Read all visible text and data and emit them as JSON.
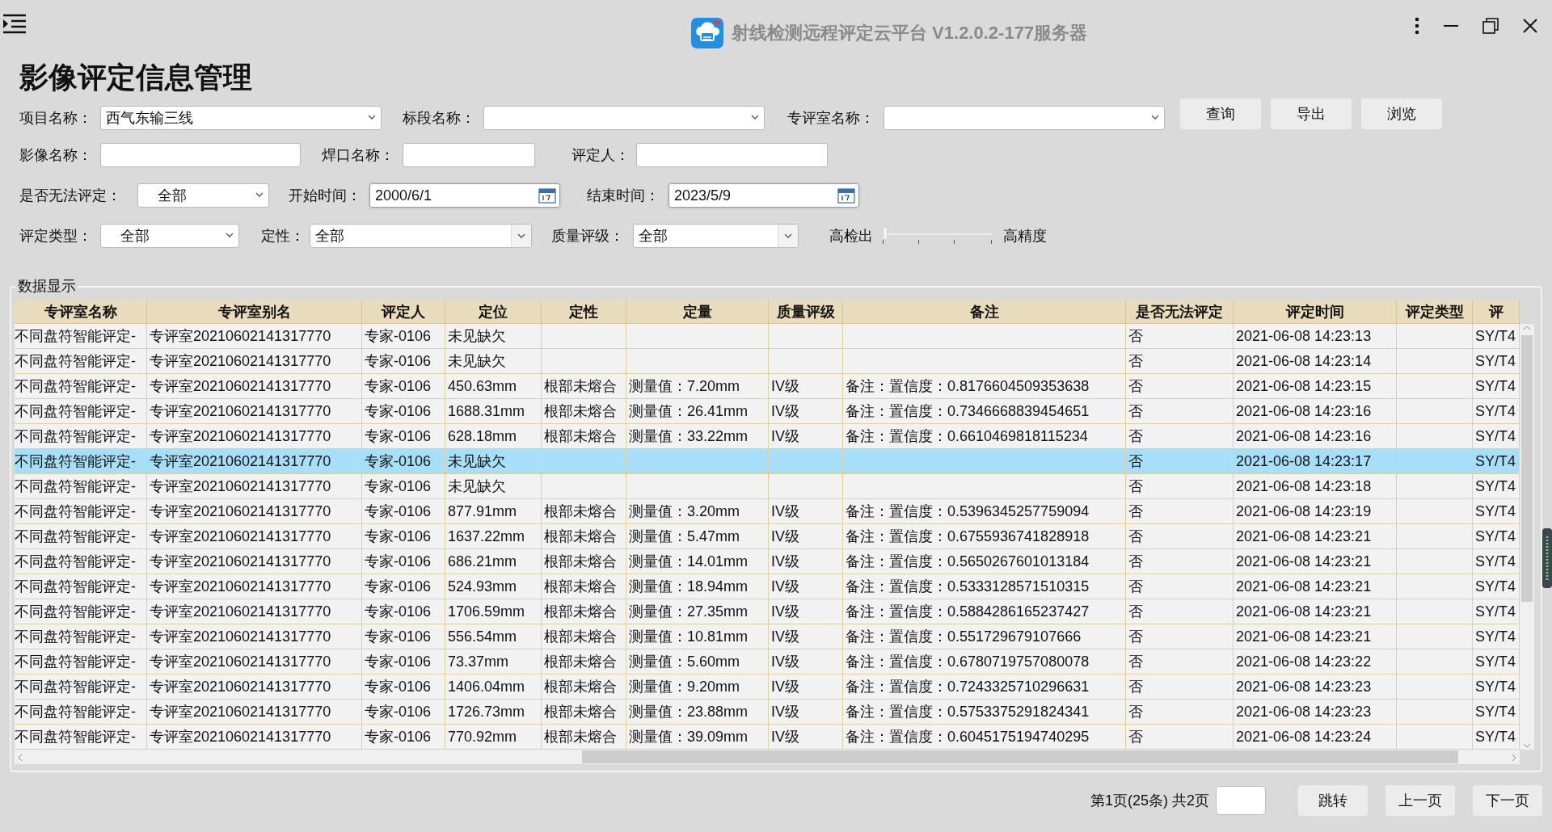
{
  "window": {
    "title": "射线检测远程评定云平台 V1.2.0.2-177服务器"
  },
  "page_title": "影像评定信息管理",
  "filters": [
    {
      "fields": [
        {
          "kind": "select",
          "label": "项目名称：",
          "value": "西气东输三线"
        },
        {
          "kind": "select",
          "label": "标段名称："
        },
        {
          "kind": "select",
          "label": "专评室名称："
        }
      ],
      "buttons": [
        "查询",
        "导出",
        "浏览"
      ]
    },
    {
      "fields": [
        {
          "kind": "text",
          "label": "影像名称："
        },
        {
          "kind": "text",
          "label": "焊口名称："
        },
        {
          "kind": "text",
          "label": "评定人："
        }
      ]
    },
    {
      "fields": [
        {
          "kind": "select",
          "label": "是否无法评定：",
          "value": "全部"
        },
        {
          "kind": "date",
          "label": "开始时间：",
          "value": "2000/6/1"
        },
        {
          "kind": "date",
          "label": "结束时间：",
          "value": "2023/5/9"
        }
      ]
    },
    {
      "fields": [
        {
          "kind": "select",
          "label": "评定类型：",
          "value": "全部"
        },
        {
          "kind": "combo",
          "label": "定性：",
          "value": "全部"
        },
        {
          "kind": "combo",
          "label": "质量评级：",
          "value": "全部"
        },
        {
          "kind": "slider",
          "label_low": "高检出",
          "label_high": "高精度",
          "level": 0
        }
      ]
    }
  ],
  "table": {
    "title": "数据显示",
    "columns": [
      "专评室名称",
      "专评室别名",
      "评定人",
      "定位",
      "定性",
      "定量",
      "质量评级",
      "备注",
      "是否无法评定",
      "评定时间",
      "评定类型",
      "评"
    ],
    "rows": [
      {
        "selected": false,
        "cells": [
          "不同盘符智能评定-",
          "专评室20210602141317770",
          "专家-0106",
          "未见缺欠",
          null,
          null,
          null,
          null,
          "否",
          "2021-06-08 14:23:13",
          null,
          "SY/T4"
        ]
      },
      {
        "selected": false,
        "cells": [
          "不同盘符智能评定-",
          "专评室20210602141317770",
          "专家-0106",
          "未见缺欠",
          null,
          null,
          null,
          null,
          "否",
          "2021-06-08 14:23:14",
          null,
          "SY/T4"
        ]
      },
      {
        "selected": false,
        "cells": [
          "不同盘符智能评定-",
          "专评室20210602141317770",
          "专家-0106",
          "450.63mm",
          "根部未熔合",
          "测量值：7.20mm",
          "IV级",
          "备注：置信度：0.8176604509353638",
          "否",
          "2021-06-08 14:23:15",
          null,
          "SY/T4"
        ]
      },
      {
        "selected": false,
        "cells": [
          "不同盘符智能评定-",
          "专评室20210602141317770",
          "专家-0106",
          "1688.31mm",
          "根部未熔合",
          "测量值：26.41mm",
          "IV级",
          "备注：置信度：0.7346668839454651",
          "否",
          "2021-06-08 14:23:16",
          null,
          "SY/T4"
        ]
      },
      {
        "selected": false,
        "cells": [
          "不同盘符智能评定-",
          "专评室20210602141317770",
          "专家-0106",
          "628.18mm",
          "根部未熔合",
          "测量值：33.22mm",
          "IV级",
          "备注：置信度：0.6610469818115234",
          "否",
          "2021-06-08 14:23:16",
          null,
          "SY/T4"
        ]
      },
      {
        "selected": true,
        "cells": [
          "不同盘符智能评定-",
          "专评室20210602141317770",
          "专家-0106",
          "未见缺欠",
          null,
          null,
          null,
          null,
          "否",
          "2021-06-08 14:23:17",
          null,
          "SY/T4"
        ]
      },
      {
        "selected": false,
        "cells": [
          "不同盘符智能评定-",
          "专评室20210602141317770",
          "专家-0106",
          "未见缺欠",
          null,
          null,
          null,
          null,
          "否",
          "2021-06-08 14:23:18",
          null,
          "SY/T4"
        ]
      },
      {
        "selected": false,
        "cells": [
          "不同盘符智能评定-",
          "专评室20210602141317770",
          "专家-0106",
          "877.91mm",
          "根部未熔合",
          "测量值：3.20mm",
          "IV级",
          "备注：置信度：0.5396345257759094",
          "否",
          "2021-06-08 14:23:19",
          null,
          "SY/T4"
        ]
      },
      {
        "selected": false,
        "cells": [
          "不同盘符智能评定-",
          "专评室20210602141317770",
          "专家-0106",
          "1637.22mm",
          "根部未熔合",
          "测量值：5.47mm",
          "IV级",
          "备注：置信度：0.6755936741828918",
          "否",
          "2021-06-08 14:23:21",
          null,
          "SY/T4"
        ]
      },
      {
        "selected": false,
        "cells": [
          "不同盘符智能评定-",
          "专评室20210602141317770",
          "专家-0106",
          "686.21mm",
          "根部未熔合",
          "测量值：14.01mm",
          "IV级",
          "备注：置信度：0.5650267601013184",
          "否",
          "2021-06-08 14:23:21",
          null,
          "SY/T4"
        ]
      },
      {
        "selected": false,
        "cells": [
          "不同盘符智能评定-",
          "专评室20210602141317770",
          "专家-0106",
          "524.93mm",
          "根部未熔合",
          "测量值：18.94mm",
          "IV级",
          "备注：置信度：0.5333128571510315",
          "否",
          "2021-06-08 14:23:21",
          null,
          "SY/T4"
        ]
      },
      {
        "selected": false,
        "cells": [
          "不同盘符智能评定-",
          "专评室20210602141317770",
          "专家-0106",
          "1706.59mm",
          "根部未熔合",
          "测量值：27.35mm",
          "IV级",
          "备注：置信度：0.5884286165237427",
          "否",
          "2021-06-08 14:23:21",
          null,
          "SY/T4"
        ]
      },
      {
        "selected": false,
        "cells": [
          "不同盘符智能评定-",
          "专评室20210602141317770",
          "专家-0106",
          "556.54mm",
          "根部未熔合",
          "测量值：10.81mm",
          "IV级",
          "备注：置信度：0.551729679107666",
          "否",
          "2021-06-08 14:23:21",
          null,
          "SY/T4"
        ]
      },
      {
        "selected": false,
        "cells": [
          "不同盘符智能评定-",
          "专评室20210602141317770",
          "专家-0106",
          "73.37mm",
          "根部未熔合",
          "测量值：5.60mm",
          "IV级",
          "备注：置信度：0.6780719757080078",
          "否",
          "2021-06-08 14:23:22",
          null,
          "SY/T4"
        ]
      },
      {
        "selected": false,
        "cells": [
          "不同盘符智能评定-",
          "专评室20210602141317770",
          "专家-0106",
          "1406.04mm",
          "根部未熔合",
          "测量值：9.20mm",
          "IV级",
          "备注：置信度：0.7243325710296631",
          "否",
          "2021-06-08 14:23:23",
          null,
          "SY/T4"
        ]
      },
      {
        "selected": false,
        "cells": [
          "不同盘符智能评定-",
          "专评室20210602141317770",
          "专家-0106",
          "1726.73mm",
          "根部未熔合",
          "测量值：23.88mm",
          "IV级",
          "备注：置信度：0.5753375291824341",
          "否",
          "2021-06-08 14:23:23",
          null,
          "SY/T4"
        ]
      },
      {
        "selected": false,
        "cells": [
          "不同盘符智能评定-",
          "专评室20210602141317770",
          "专家-0106",
          "770.92mm",
          "根部未熔合",
          "测量值：39.09mm",
          "IV级",
          "备注：置信度：0.6045175194740295",
          "否",
          "2021-06-08 14:23:24",
          null,
          "SY/T4"
        ]
      }
    ]
  },
  "pager": {
    "info": "第1页(25条) 共2页",
    "buttons": [
      "跳转",
      "上一页",
      "下一页"
    ]
  }
}
